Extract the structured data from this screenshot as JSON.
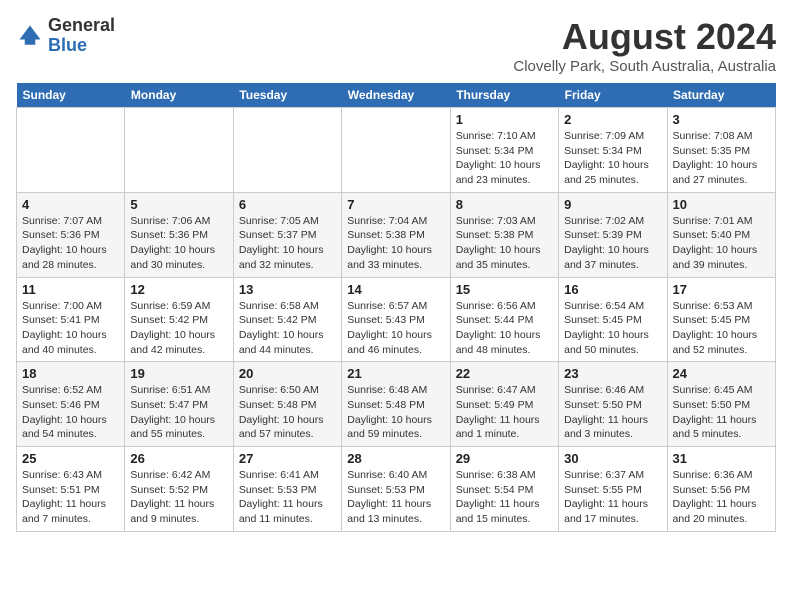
{
  "header": {
    "logo_general": "General",
    "logo_blue": "Blue",
    "month_title": "August 2024",
    "location": "Clovelly Park, South Australia, Australia"
  },
  "weekdays": [
    "Sunday",
    "Monday",
    "Tuesday",
    "Wednesday",
    "Thursday",
    "Friday",
    "Saturday"
  ],
  "weeks": [
    [
      {
        "day": "",
        "sunrise": "",
        "sunset": "",
        "daylight": ""
      },
      {
        "day": "",
        "sunrise": "",
        "sunset": "",
        "daylight": ""
      },
      {
        "day": "",
        "sunrise": "",
        "sunset": "",
        "daylight": ""
      },
      {
        "day": "",
        "sunrise": "",
        "sunset": "",
        "daylight": ""
      },
      {
        "day": "1",
        "sunrise": "Sunrise: 7:10 AM",
        "sunset": "Sunset: 5:34 PM",
        "daylight": "Daylight: 10 hours and 23 minutes."
      },
      {
        "day": "2",
        "sunrise": "Sunrise: 7:09 AM",
        "sunset": "Sunset: 5:34 PM",
        "daylight": "Daylight: 10 hours and 25 minutes."
      },
      {
        "day": "3",
        "sunrise": "Sunrise: 7:08 AM",
        "sunset": "Sunset: 5:35 PM",
        "daylight": "Daylight: 10 hours and 27 minutes."
      }
    ],
    [
      {
        "day": "4",
        "sunrise": "Sunrise: 7:07 AM",
        "sunset": "Sunset: 5:36 PM",
        "daylight": "Daylight: 10 hours and 28 minutes."
      },
      {
        "day": "5",
        "sunrise": "Sunrise: 7:06 AM",
        "sunset": "Sunset: 5:36 PM",
        "daylight": "Daylight: 10 hours and 30 minutes."
      },
      {
        "day": "6",
        "sunrise": "Sunrise: 7:05 AM",
        "sunset": "Sunset: 5:37 PM",
        "daylight": "Daylight: 10 hours and 32 minutes."
      },
      {
        "day": "7",
        "sunrise": "Sunrise: 7:04 AM",
        "sunset": "Sunset: 5:38 PM",
        "daylight": "Daylight: 10 hours and 33 minutes."
      },
      {
        "day": "8",
        "sunrise": "Sunrise: 7:03 AM",
        "sunset": "Sunset: 5:38 PM",
        "daylight": "Daylight: 10 hours and 35 minutes."
      },
      {
        "day": "9",
        "sunrise": "Sunrise: 7:02 AM",
        "sunset": "Sunset: 5:39 PM",
        "daylight": "Daylight: 10 hours and 37 minutes."
      },
      {
        "day": "10",
        "sunrise": "Sunrise: 7:01 AM",
        "sunset": "Sunset: 5:40 PM",
        "daylight": "Daylight: 10 hours and 39 minutes."
      }
    ],
    [
      {
        "day": "11",
        "sunrise": "Sunrise: 7:00 AM",
        "sunset": "Sunset: 5:41 PM",
        "daylight": "Daylight: 10 hours and 40 minutes."
      },
      {
        "day": "12",
        "sunrise": "Sunrise: 6:59 AM",
        "sunset": "Sunset: 5:42 PM",
        "daylight": "Daylight: 10 hours and 42 minutes."
      },
      {
        "day": "13",
        "sunrise": "Sunrise: 6:58 AM",
        "sunset": "Sunset: 5:42 PM",
        "daylight": "Daylight: 10 hours and 44 minutes."
      },
      {
        "day": "14",
        "sunrise": "Sunrise: 6:57 AM",
        "sunset": "Sunset: 5:43 PM",
        "daylight": "Daylight: 10 hours and 46 minutes."
      },
      {
        "day": "15",
        "sunrise": "Sunrise: 6:56 AM",
        "sunset": "Sunset: 5:44 PM",
        "daylight": "Daylight: 10 hours and 48 minutes."
      },
      {
        "day": "16",
        "sunrise": "Sunrise: 6:54 AM",
        "sunset": "Sunset: 5:45 PM",
        "daylight": "Daylight: 10 hours and 50 minutes."
      },
      {
        "day": "17",
        "sunrise": "Sunrise: 6:53 AM",
        "sunset": "Sunset: 5:45 PM",
        "daylight": "Daylight: 10 hours and 52 minutes."
      }
    ],
    [
      {
        "day": "18",
        "sunrise": "Sunrise: 6:52 AM",
        "sunset": "Sunset: 5:46 PM",
        "daylight": "Daylight: 10 hours and 54 minutes."
      },
      {
        "day": "19",
        "sunrise": "Sunrise: 6:51 AM",
        "sunset": "Sunset: 5:47 PM",
        "daylight": "Daylight: 10 hours and 55 minutes."
      },
      {
        "day": "20",
        "sunrise": "Sunrise: 6:50 AM",
        "sunset": "Sunset: 5:48 PM",
        "daylight": "Daylight: 10 hours and 57 minutes."
      },
      {
        "day": "21",
        "sunrise": "Sunrise: 6:48 AM",
        "sunset": "Sunset: 5:48 PM",
        "daylight": "Daylight: 10 hours and 59 minutes."
      },
      {
        "day": "22",
        "sunrise": "Sunrise: 6:47 AM",
        "sunset": "Sunset: 5:49 PM",
        "daylight": "Daylight: 11 hours and 1 minute."
      },
      {
        "day": "23",
        "sunrise": "Sunrise: 6:46 AM",
        "sunset": "Sunset: 5:50 PM",
        "daylight": "Daylight: 11 hours and 3 minutes."
      },
      {
        "day": "24",
        "sunrise": "Sunrise: 6:45 AM",
        "sunset": "Sunset: 5:50 PM",
        "daylight": "Daylight: 11 hours and 5 minutes."
      }
    ],
    [
      {
        "day": "25",
        "sunrise": "Sunrise: 6:43 AM",
        "sunset": "Sunset: 5:51 PM",
        "daylight": "Daylight: 11 hours and 7 minutes."
      },
      {
        "day": "26",
        "sunrise": "Sunrise: 6:42 AM",
        "sunset": "Sunset: 5:52 PM",
        "daylight": "Daylight: 11 hours and 9 minutes."
      },
      {
        "day": "27",
        "sunrise": "Sunrise: 6:41 AM",
        "sunset": "Sunset: 5:53 PM",
        "daylight": "Daylight: 11 hours and 11 minutes."
      },
      {
        "day": "28",
        "sunrise": "Sunrise: 6:40 AM",
        "sunset": "Sunset: 5:53 PM",
        "daylight": "Daylight: 11 hours and 13 minutes."
      },
      {
        "day": "29",
        "sunrise": "Sunrise: 6:38 AM",
        "sunset": "Sunset: 5:54 PM",
        "daylight": "Daylight: 11 hours and 15 minutes."
      },
      {
        "day": "30",
        "sunrise": "Sunrise: 6:37 AM",
        "sunset": "Sunset: 5:55 PM",
        "daylight": "Daylight: 11 hours and 17 minutes."
      },
      {
        "day": "31",
        "sunrise": "Sunrise: 6:36 AM",
        "sunset": "Sunset: 5:56 PM",
        "daylight": "Daylight: 11 hours and 20 minutes."
      }
    ]
  ]
}
